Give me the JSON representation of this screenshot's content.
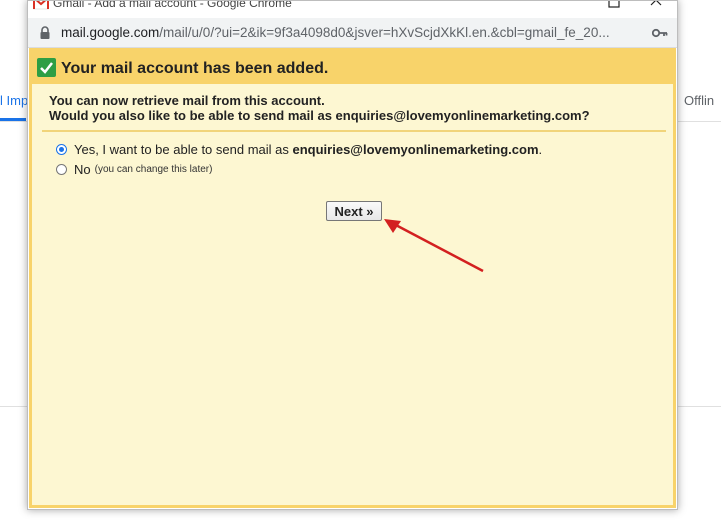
{
  "background": {
    "left_tab_label": "l Imp",
    "right_tab_label": "Offlin"
  },
  "window": {
    "title": "Gmail - Add a mail account - Google Chrome",
    "url_domain": "mail.google.com",
    "url_path": "/mail/u/0/?ui=2&ik=9f3a4098d0&jsver=hXvScjdXkKl.en.&cbl=gmail_fe_20..."
  },
  "dialog": {
    "header_title": "Your mail account has been added.",
    "intro_line1": "You can now retrieve mail from this account.",
    "intro_line2": "Would you also like to be able to send mail as enquiries@lovemyonlinemarketing.com?",
    "options": [
      {
        "label_prefix": "Yes, I want to be able to send mail as ",
        "email": "enquiries@lovemyonlinemarketing.com",
        "label_suffix": ".",
        "checked": true
      },
      {
        "label": "No",
        "note": "(you can change this later)",
        "checked": false
      }
    ],
    "next_label": "Next »"
  },
  "colors": {
    "header_bar": "#f8d36a",
    "content_bg": "#fdf7d2",
    "check_green": "#2e9e44",
    "annotation_arrow": "#d32020"
  }
}
